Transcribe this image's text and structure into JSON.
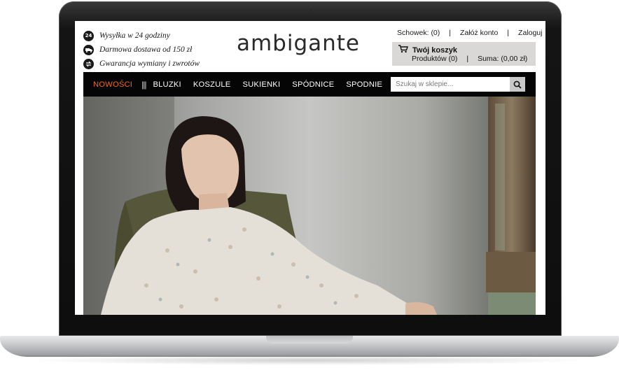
{
  "perks": [
    {
      "icon": "24",
      "icon_name": "24h-badge-icon",
      "text": "Wysyłka w 24 godziny"
    },
    {
      "icon": "",
      "icon_name": "delivery-truck-icon",
      "text": "Darmowa dostawa od 150 zł"
    },
    {
      "icon": "",
      "icon_name": "exchange-arrows-icon",
      "text": "Gwarancja wymiany i zwrotów"
    }
  ],
  "logo": "ambigante",
  "top_links": {
    "wishlist": "Schowek: (0)",
    "separator": "|",
    "register": "Załóż konto",
    "login": "Zaloguj"
  },
  "cart": {
    "title": "Twój koszyk",
    "products": "Produktów (0)",
    "separator": "|",
    "total": "Suma: (0,00 zł)"
  },
  "nav": {
    "active": "NOWOŚCI",
    "divider": "|||",
    "items": [
      "BLUZKI",
      "KOSZULE",
      "SUKIENKI",
      "SPÓDNICE",
      "SPODNIE"
    ]
  },
  "search": {
    "placeholder": "Szukaj w sklepie..."
  },
  "colors": {
    "accent": "#ee6a1f",
    "nav_bg": "#050505",
    "cart_bg": "#d9d8d6"
  }
}
